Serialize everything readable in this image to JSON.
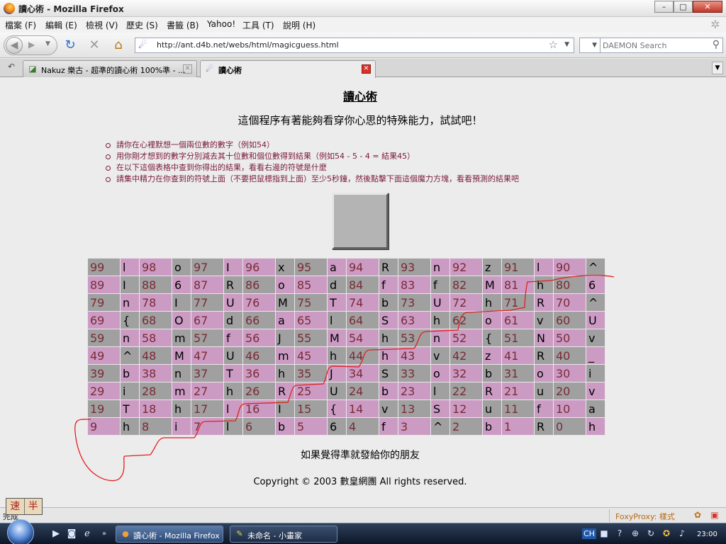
{
  "window": {
    "title": "讀心術 - Mozilla Firefox"
  },
  "menu": [
    "檔案 (F)",
    "編輯 (E)",
    "檢視 (V)",
    "歷史 (S)",
    "書籤 (B)",
    "Yahoo!",
    "工具 (T)",
    "說明 (H)"
  ],
  "nav": {
    "url": "http://ant.d4b.net/webs/html/magicguess.html",
    "search_engine": "DAEMON Search"
  },
  "tabs": [
    {
      "label": "Nakuz 樂古 - 超準的讀心術 100%準 - ...",
      "active": false
    },
    {
      "label": "讀心術",
      "active": true
    }
  ],
  "page": {
    "title": "讀心術",
    "subtitle": "這個程序有著能夠看穿你心思的特殊能力，試試吧！",
    "instructions": [
      "請你在心裡默想一個兩位數的數字（例如54）",
      "用你剛才想到的數字分別減去其十位數和個位數得到結果（例如54 - 5 - 4 = 結果45）",
      "在以下這個表格中查到你得出的結果，看看右邊的符號是什麼",
      "請集中精力在你查到的符號上面（不要把鼠標指到上面）至少5秒鐘，然後點擊下面這個魔力方塊，看看預測的結果吧"
    ],
    "grid": [
      [
        [
          "99",
          "l"
        ],
        [
          "98",
          "o"
        ],
        [
          "97",
          "I"
        ],
        [
          "96",
          "x"
        ],
        [
          "95",
          "a"
        ],
        [
          "94",
          "R"
        ],
        [
          "93",
          "n"
        ],
        [
          "92",
          "z"
        ],
        [
          "91",
          "l"
        ],
        [
          "90",
          "^"
        ]
      ],
      [
        [
          "89",
          "I"
        ],
        [
          "88",
          "6"
        ],
        [
          "87",
          "R"
        ],
        [
          "86",
          "o"
        ],
        [
          "85",
          "d"
        ],
        [
          "84",
          "f"
        ],
        [
          "83",
          "f"
        ],
        [
          "82",
          "M"
        ],
        [
          "81",
          "h"
        ],
        [
          "80",
          "6"
        ]
      ],
      [
        [
          "79",
          "n"
        ],
        [
          "78",
          "I"
        ],
        [
          "77",
          "U"
        ],
        [
          "76",
          "M"
        ],
        [
          "75",
          "T"
        ],
        [
          "74",
          "b"
        ],
        [
          "73",
          "U"
        ],
        [
          "72",
          "h"
        ],
        [
          "71",
          "R"
        ],
        [
          "70",
          "^"
        ]
      ],
      [
        [
          "69",
          "{"
        ],
        [
          "68",
          "O"
        ],
        [
          "67",
          "d"
        ],
        [
          "66",
          "a"
        ],
        [
          "65",
          "l"
        ],
        [
          "64",
          "S"
        ],
        [
          "63",
          "h"
        ],
        [
          "62",
          "o"
        ],
        [
          "61",
          "v"
        ],
        [
          "60",
          "U"
        ]
      ],
      [
        [
          "59",
          "n"
        ],
        [
          "58",
          "m"
        ],
        [
          "57",
          "f"
        ],
        [
          "56",
          "J"
        ],
        [
          "55",
          "M"
        ],
        [
          "54",
          "h"
        ],
        [
          "53",
          "n"
        ],
        [
          "52",
          "{"
        ],
        [
          "51",
          "N"
        ],
        [
          "50",
          "v"
        ]
      ],
      [
        [
          "49",
          "^"
        ],
        [
          "48",
          "M"
        ],
        [
          "47",
          "U"
        ],
        [
          "46",
          "m"
        ],
        [
          "45",
          "h"
        ],
        [
          "44",
          "h"
        ],
        [
          "43",
          "v"
        ],
        [
          "42",
          "z"
        ],
        [
          "41",
          "R"
        ],
        [
          "40",
          "_"
        ]
      ],
      [
        [
          "39",
          "b"
        ],
        [
          "38",
          "n"
        ],
        [
          "37",
          "T"
        ],
        [
          "36",
          "h"
        ],
        [
          "35",
          "J"
        ],
        [
          "34",
          "S"
        ],
        [
          "33",
          "o"
        ],
        [
          "32",
          "b"
        ],
        [
          "31",
          "o"
        ],
        [
          "30",
          "i"
        ]
      ],
      [
        [
          "29",
          "i"
        ],
        [
          "28",
          "m"
        ],
        [
          "27",
          "h"
        ],
        [
          "26",
          "R"
        ],
        [
          "25",
          "U"
        ],
        [
          "24",
          "b"
        ],
        [
          "23",
          "l"
        ],
        [
          "22",
          "R"
        ],
        [
          "21",
          "u"
        ],
        [
          "20",
          "v"
        ]
      ],
      [
        [
          "19",
          "T"
        ],
        [
          "18",
          "h"
        ],
        [
          "17",
          "l"
        ],
        [
          "16",
          "I"
        ],
        [
          "15",
          "{"
        ],
        [
          "14",
          "v"
        ],
        [
          "13",
          "S"
        ],
        [
          "12",
          "u"
        ],
        [
          "11",
          "f"
        ],
        [
          "10",
          "a"
        ]
      ],
      [
        [
          "9",
          "h"
        ],
        [
          "8",
          "i"
        ],
        [
          "7",
          "l"
        ],
        [
          "6",
          "b"
        ],
        [
          "5",
          "6"
        ],
        [
          "4",
          "f"
        ],
        [
          "3",
          "^"
        ],
        [
          "2",
          "b"
        ],
        [
          "1",
          "R"
        ],
        [
          "0",
          "h"
        ]
      ]
    ],
    "share": "如果覺得準就發給你的朋友",
    "copyright": "Copyright © 2003 數皇網團 All rights reserved."
  },
  "ime": [
    "速",
    "半"
  ],
  "status": {
    "text": "完成",
    "proxy": "FoxyProxy: 樣式(P)"
  },
  "taskbar": {
    "items": [
      "讀心術 - Mozilla Firefox",
      "未命名 - 小畫家"
    ],
    "lang": "CH",
    "clock": "23:00"
  },
  "colors": {
    "cell_pink": "#cc9bc4",
    "cell_gray": "#a0a0a0",
    "number_text": "#7a2a35",
    "annotation": "#e02020"
  }
}
